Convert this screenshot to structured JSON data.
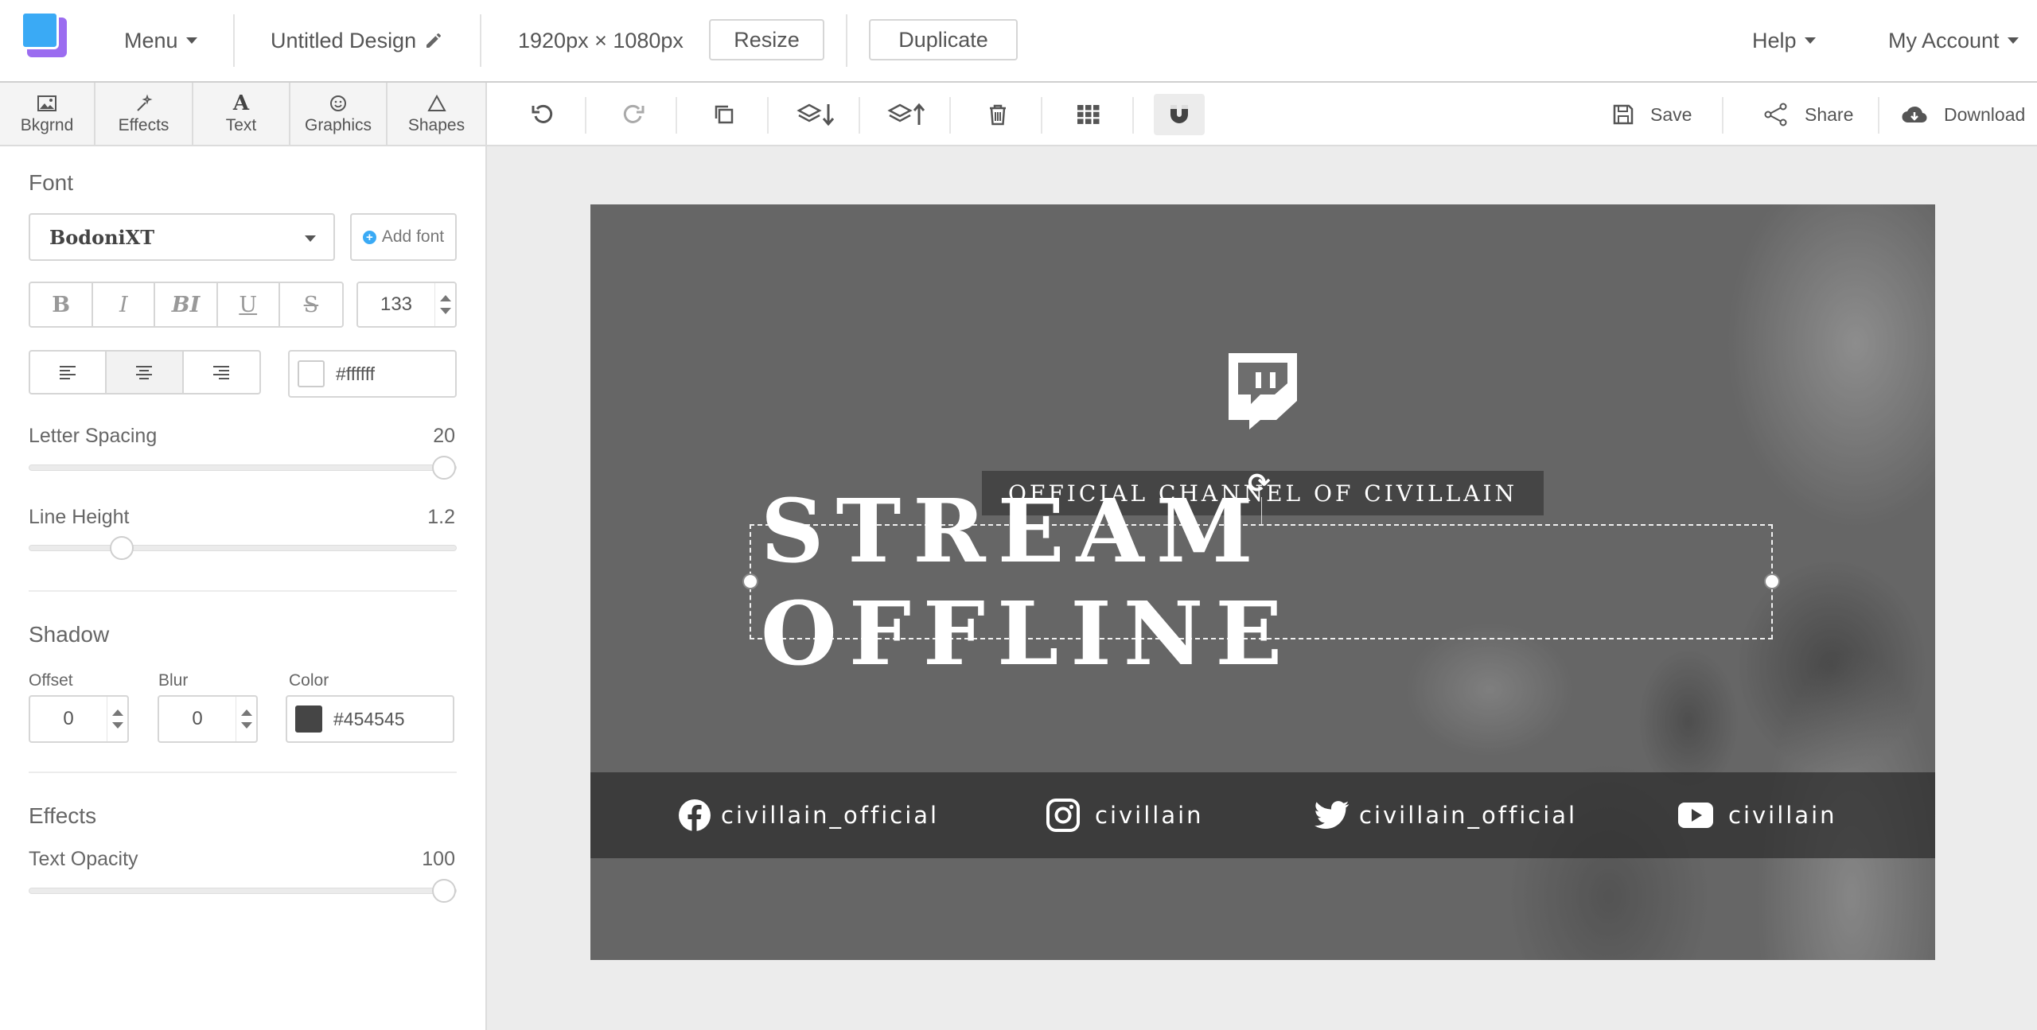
{
  "header": {
    "menu_label": "Menu",
    "design_title": "Untitled Design",
    "dimensions": "1920px × 1080px",
    "resize_label": "Resize",
    "duplicate_label": "Duplicate",
    "help_label": "Help",
    "account_label": "My Account"
  },
  "left_tabs": [
    {
      "label": "Bkgrnd",
      "icon": "image-icon"
    },
    {
      "label": "Effects",
      "icon": "magic-wand-icon"
    },
    {
      "label": "Text",
      "icon": "text-icon"
    },
    {
      "label": "Graphics",
      "icon": "smiley-icon"
    },
    {
      "label": "Shapes",
      "icon": "triangle-icon"
    }
  ],
  "font_panel": {
    "font_heading": "Font",
    "font_family": "BodoniXT",
    "add_font_label": "Add font",
    "style_buttons": [
      "B",
      "I",
      "BI",
      "U",
      "S"
    ],
    "font_size": "133",
    "text_color": "#ffffff",
    "letter_spacing_label": "Letter Spacing",
    "letter_spacing_value": "20",
    "letter_spacing_fraction": 1.0,
    "line_height_label": "Line Height",
    "line_height_value": "1.2",
    "line_height_fraction": 0.2,
    "shadow_heading": "Shadow",
    "offset_label": "Offset",
    "offset_value": "0",
    "blur_label": "Blur",
    "blur_value": "0",
    "shadow_color_label": "Color",
    "shadow_color": "#454545",
    "effects_heading": "Effects",
    "opacity_label": "Text Opacity",
    "opacity_value": "100",
    "opacity_fraction": 1.0
  },
  "toolbar": {
    "save_label": "Save",
    "share_label": "Share",
    "download_label": "Download"
  },
  "canvas": {
    "subtitle": "OFFICIAL CHANNEL OF CIVILLAIN",
    "title": "STREAM OFFLINE",
    "socials": [
      {
        "platform": "facebook",
        "handle": "civillain_official"
      },
      {
        "platform": "instagram",
        "handle": "civillain"
      },
      {
        "platform": "twitter",
        "handle": "civillain_official"
      },
      {
        "platform": "youtube",
        "handle": "civillain"
      }
    ]
  },
  "colors": {
    "accent": "#3aaaf5",
    "logo_secondary": "#9b6cf0"
  }
}
